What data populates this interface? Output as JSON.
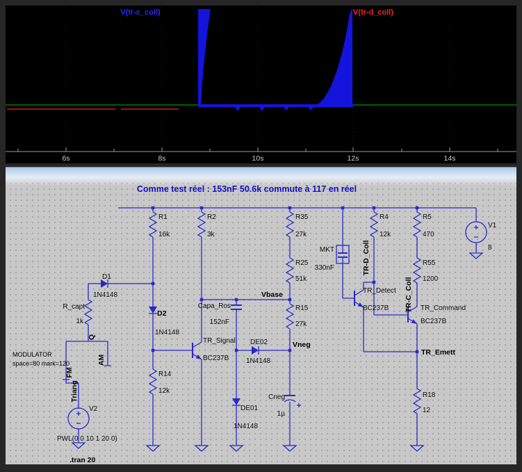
{
  "colors": {
    "wire": "#2828cc",
    "title": "#1111c2",
    "blue": "#1414dd",
    "red": "#e01212",
    "green": "#009600",
    "axis": "#9a9a9a"
  },
  "plot": {
    "traces": [
      {
        "label": "V(tr-c_coll)",
        "color": "#2a2aff"
      },
      {
        "label": "V(tr-d_coll)",
        "color": "#ff2020"
      }
    ],
    "x_ticks": [
      "6s",
      "8s",
      "10s",
      "12s",
      "14s"
    ]
  },
  "schematic": {
    "title": "Comme test réel : 153nF 50.6k commute à 117  en réel",
    "components": {
      "r1": {
        "name": "R1",
        "value": "16k"
      },
      "r2": {
        "name": "R2",
        "value": "3k"
      },
      "r35": {
        "name": "R35",
        "value": "27k"
      },
      "r25": {
        "name": "R25",
        "value": "51k"
      },
      "r15": {
        "name": "R15",
        "value": "27k"
      },
      "r4": {
        "name": "R4",
        "value": "12k"
      },
      "r5": {
        "name": "R5",
        "value": "470"
      },
      "r55": {
        "name": "R55",
        "value": "1200"
      },
      "r14": {
        "name": "R14",
        "value": "12k"
      },
      "r18": {
        "name": "R18",
        "value": "12"
      },
      "r_capt": {
        "name": "R_capt",
        "value": "1k"
      },
      "d1": {
        "name": "D1",
        "value": "1N4148"
      },
      "d2": {
        "name": "D2",
        "value": "1N4148"
      },
      "de01": {
        "name": "DE01",
        "value": "1N4148"
      },
      "de02": {
        "name": "DE02",
        "value": "1N4148"
      },
      "capa_ros": {
        "name": "Capa_Ros",
        "value": "152nF"
      },
      "mkt": {
        "name": "MKT",
        "value": "330nF"
      },
      "cneg": {
        "name": "Cneg",
        "value": "1µ"
      },
      "tr_signal": {
        "name": "TR_Signal",
        "value": "BC237B"
      },
      "tr_detect": {
        "name": "TR_Detect",
        "value": "BC237B"
      },
      "tr_command": {
        "name": "TR_Command",
        "value": "BC237B"
      },
      "v1": {
        "name": "V1",
        "value": "8"
      },
      "v2": {
        "name": "V2",
        "value": "PWL(0 0 10 1 20 0)"
      }
    },
    "net_labels": {
      "vbase": "Vbase",
      "vneg": "Vneg",
      "tr_emett": "TR_Emett",
      "tr_d_coll": "TR-D_Coll",
      "tr_c_coll": "TR-C_Coll",
      "q": "Q",
      "fm": "FM",
      "am": "AM",
      "triang": "Triang"
    },
    "annotations": {
      "modulator1": "MODULATOR",
      "modulator2": "space=80 mark=120",
      "tran": ".tran 20"
    }
  }
}
